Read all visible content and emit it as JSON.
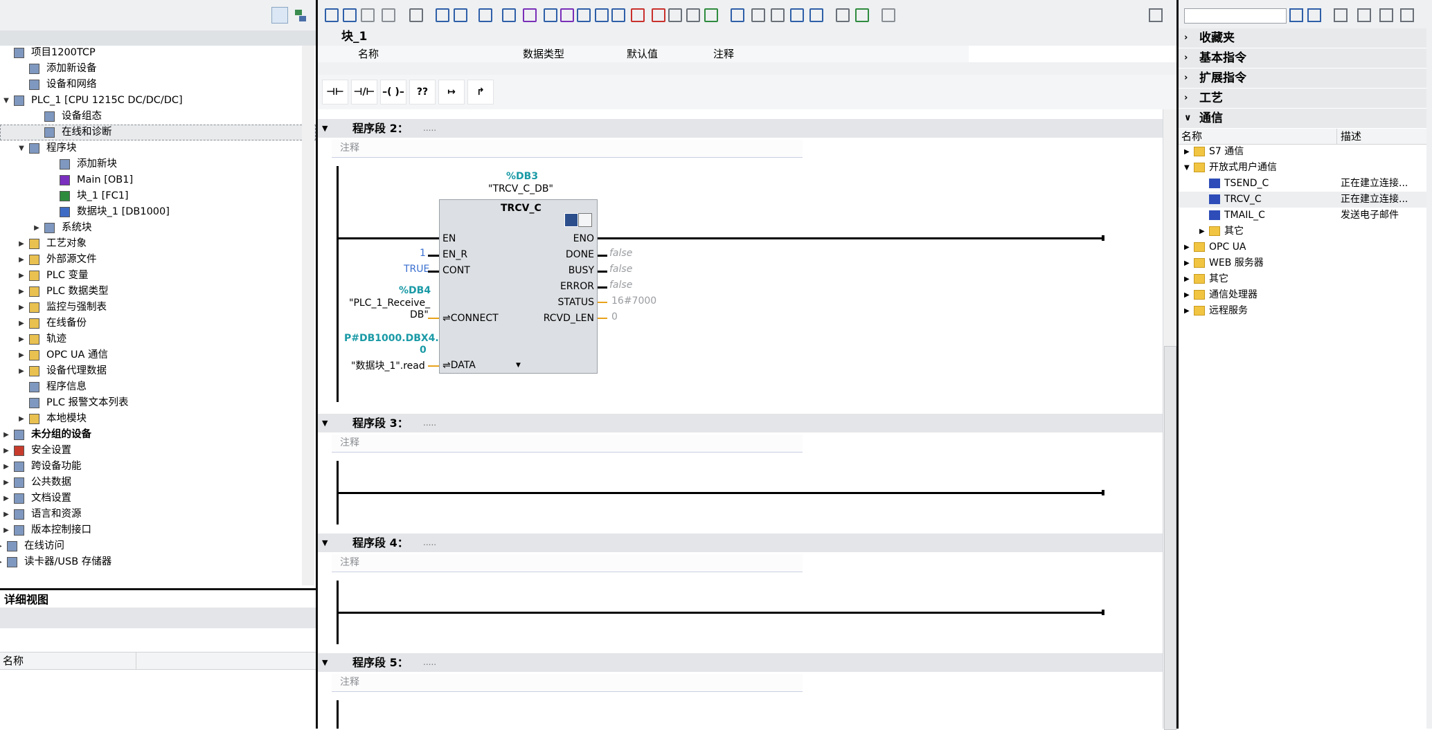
{
  "project_tree": {
    "items": [
      {
        "label": "项目1200TCP",
        "level": 0,
        "toggle": "",
        "icon": "project-icon",
        "bold": false
      },
      {
        "label": "添加新设备",
        "level": 1,
        "toggle": "",
        "icon": "add-device-icon",
        "bold": false
      },
      {
        "label": "设备和网络",
        "level": 1,
        "toggle": "",
        "icon": "network-icon",
        "bold": false
      },
      {
        "label": "PLC_1 [CPU 1215C DC/DC/DC]",
        "level": 0,
        "toggle": "▼",
        "icon": "plc-icon",
        "bold": false
      },
      {
        "label": "设备组态",
        "level": 2,
        "toggle": "",
        "icon": "device-config-icon",
        "bold": false
      },
      {
        "label": "在线和诊断",
        "level": 2,
        "toggle": "",
        "icon": "diagnostics-icon",
        "bold": false,
        "selected": true
      },
      {
        "label": "程序块",
        "level": 1,
        "toggle": "▼",
        "icon": "program-blocks-icon",
        "bold": false
      },
      {
        "label": "添加新块",
        "level": 3,
        "toggle": "",
        "icon": "add-block-icon",
        "bold": false
      },
      {
        "label": "Main [OB1]",
        "level": 3,
        "toggle": "",
        "icon": "ob-icon",
        "bold": false
      },
      {
        "label": "块_1 [FC1]",
        "level": 3,
        "toggle": "",
        "icon": "fc-icon",
        "bold": false
      },
      {
        "label": "数据块_1 [DB1000]",
        "level": 3,
        "toggle": "",
        "icon": "db-icon",
        "bold": false
      },
      {
        "label": "系统块",
        "level": 2,
        "toggle": "▶",
        "icon": "system-blocks-icon",
        "bold": false
      },
      {
        "label": "工艺对象",
        "level": 1,
        "toggle": "▶",
        "icon": "folder-icon",
        "bold": false
      },
      {
        "label": "外部源文件",
        "level": 1,
        "toggle": "▶",
        "icon": "folder-icon",
        "bold": false
      },
      {
        "label": "PLC 变量",
        "level": 1,
        "toggle": "▶",
        "icon": "folder-icon",
        "bold": false
      },
      {
        "label": "PLC 数据类型",
        "level": 1,
        "toggle": "▶",
        "icon": "folder-icon",
        "bold": false
      },
      {
        "label": "监控与强制表",
        "level": 1,
        "toggle": "▶",
        "icon": "folder-icon",
        "bold": false
      },
      {
        "label": "在线备份",
        "level": 1,
        "toggle": "▶",
        "icon": "folder-icon",
        "bold": false
      },
      {
        "label": "轨迹",
        "level": 1,
        "toggle": "▶",
        "icon": "folder-icon",
        "bold": false
      },
      {
        "label": "OPC UA 通信",
        "level": 1,
        "toggle": "▶",
        "icon": "folder-icon",
        "bold": false
      },
      {
        "label": "设备代理数据",
        "level": 1,
        "toggle": "▶",
        "icon": "folder-icon",
        "bold": false
      },
      {
        "label": "程序信息",
        "level": 1,
        "toggle": "",
        "icon": "program-info-icon",
        "bold": false
      },
      {
        "label": "PLC 报警文本列表",
        "level": 1,
        "toggle": "",
        "icon": "alarm-text-icon",
        "bold": false
      },
      {
        "label": "本地模块",
        "level": 1,
        "toggle": "▶",
        "icon": "folder-icon",
        "bold": false
      },
      {
        "label": "未分组的设备",
        "level": 0,
        "toggle": "▶",
        "icon": "ungrouped-devices-icon",
        "bold": true
      },
      {
        "label": "安全设置",
        "level": 0,
        "toggle": "▶",
        "icon": "security-icon",
        "bold": false
      },
      {
        "label": "跨设备功能",
        "level": 0,
        "toggle": "▶",
        "icon": "cross-device-icon",
        "bold": false
      },
      {
        "label": "公共数据",
        "level": 0,
        "toggle": "▶",
        "icon": "common-data-icon",
        "bold": false
      },
      {
        "label": "文档设置",
        "level": 0,
        "toggle": "▶",
        "icon": "document-icon",
        "bold": false
      },
      {
        "label": "语言和资源",
        "level": 0,
        "toggle": "▶",
        "icon": "language-icon",
        "bold": false
      },
      {
        "label": "版本控制接口",
        "level": 0,
        "toggle": "▶",
        "icon": "version-control-icon",
        "bold": false
      },
      {
        "label": "在线访问",
        "level": -1,
        "toggle": "▶",
        "icon": "online-access-icon",
        "bold": false
      },
      {
        "label": "读卡器/USB 存储器",
        "level": -1,
        "toggle": "▶",
        "icon": "card-reader-icon",
        "bold": false
      }
    ]
  },
  "detail_view": {
    "title": "详细视图",
    "column_name": "名称"
  },
  "editor": {
    "block_title": "块_1",
    "interface_columns": [
      "名称",
      "数据类型",
      "默认值",
      "注释"
    ],
    "instructions": [
      "⊣⊢",
      "⊣/⊢",
      "–( )–",
      "??",
      "↦",
      "↱"
    ],
    "networks": [
      {
        "title": "程序段 2：",
        "dots": ".....",
        "comment": "注释"
      },
      {
        "title": "程序段 3：",
        "dots": ".....",
        "comment": "注释"
      },
      {
        "title": "程序段 4：",
        "dots": ".....",
        "comment": "注释"
      },
      {
        "title": "程序段 5：",
        "dots": ".....",
        "comment": "注释"
      }
    ],
    "fb": {
      "instance_db": "%DB3",
      "instance_name": "\"TRCV_C_DB\"",
      "type": "TRCV_C",
      "inputs": [
        {
          "pin": "EN",
          "value": ""
        },
        {
          "pin": "EN_R",
          "value": "1"
        },
        {
          "pin": "CONT",
          "value": "TRUE"
        },
        {
          "pin": "CONNECT",
          "value_line1": "%DB4",
          "value_line2": "\"PLC_1_Receive_",
          "value_line3": "DB\""
        },
        {
          "pin": "DATA",
          "value_line1": "P#DB1000.DBX4.",
          "value_line2": "0",
          "value_line3": "\"数据块_1\".read"
        }
      ],
      "outputs": [
        {
          "pin": "ENO",
          "value": ""
        },
        {
          "pin": "DONE",
          "value": "false"
        },
        {
          "pin": "BUSY",
          "value": "false"
        },
        {
          "pin": "ERROR",
          "value": "false"
        },
        {
          "pin": "STATUS",
          "value": "16#7000"
        },
        {
          "pin": "RCVD_LEN",
          "value": "0"
        }
      ]
    }
  },
  "instructions_pane": {
    "sections": [
      "收藏夹",
      "基本指令",
      "扩展指令",
      "工艺",
      "通信"
    ],
    "columns": {
      "name": "名称",
      "desc": "描述"
    },
    "items": [
      {
        "label": "S7 通信",
        "level": 0,
        "toggle": "▶",
        "icon": "folder",
        "desc": ""
      },
      {
        "label": "开放式用户通信",
        "level": 0,
        "toggle": "▼",
        "icon": "folder",
        "desc": ""
      },
      {
        "label": "TSEND_C",
        "level": 1,
        "toggle": "",
        "icon": "fb",
        "desc": "正在建立连接..."
      },
      {
        "label": "TRCV_C",
        "level": 1,
        "toggle": "",
        "icon": "fb",
        "desc": "正在建立连接...",
        "selected": true
      },
      {
        "label": "TMAIL_C",
        "level": 1,
        "toggle": "",
        "icon": "fb",
        "desc": "发送电子邮件"
      },
      {
        "label": "其它",
        "level": 1,
        "toggle": "▶",
        "icon": "folder",
        "desc": ""
      },
      {
        "label": "OPC UA",
        "level": 0,
        "toggle": "▶",
        "icon": "folder",
        "desc": ""
      },
      {
        "label": "WEB 服务器",
        "level": 0,
        "toggle": "▶",
        "icon": "folder",
        "desc": ""
      },
      {
        "label": "其它",
        "level": 0,
        "toggle": "▶",
        "icon": "folder",
        "desc": ""
      },
      {
        "label": "通信处理器",
        "level": 0,
        "toggle": "▶",
        "icon": "folder",
        "desc": ""
      },
      {
        "label": "远程服务",
        "level": 0,
        "toggle": "▶",
        "icon": "folder",
        "desc": ""
      }
    ]
  },
  "colors": {
    "accent_cyan": "#1a9aa6",
    "false_grey": "#9a9ca0",
    "true_blue": "#3a6fd0",
    "wire_yellow": "#e8a21a"
  }
}
